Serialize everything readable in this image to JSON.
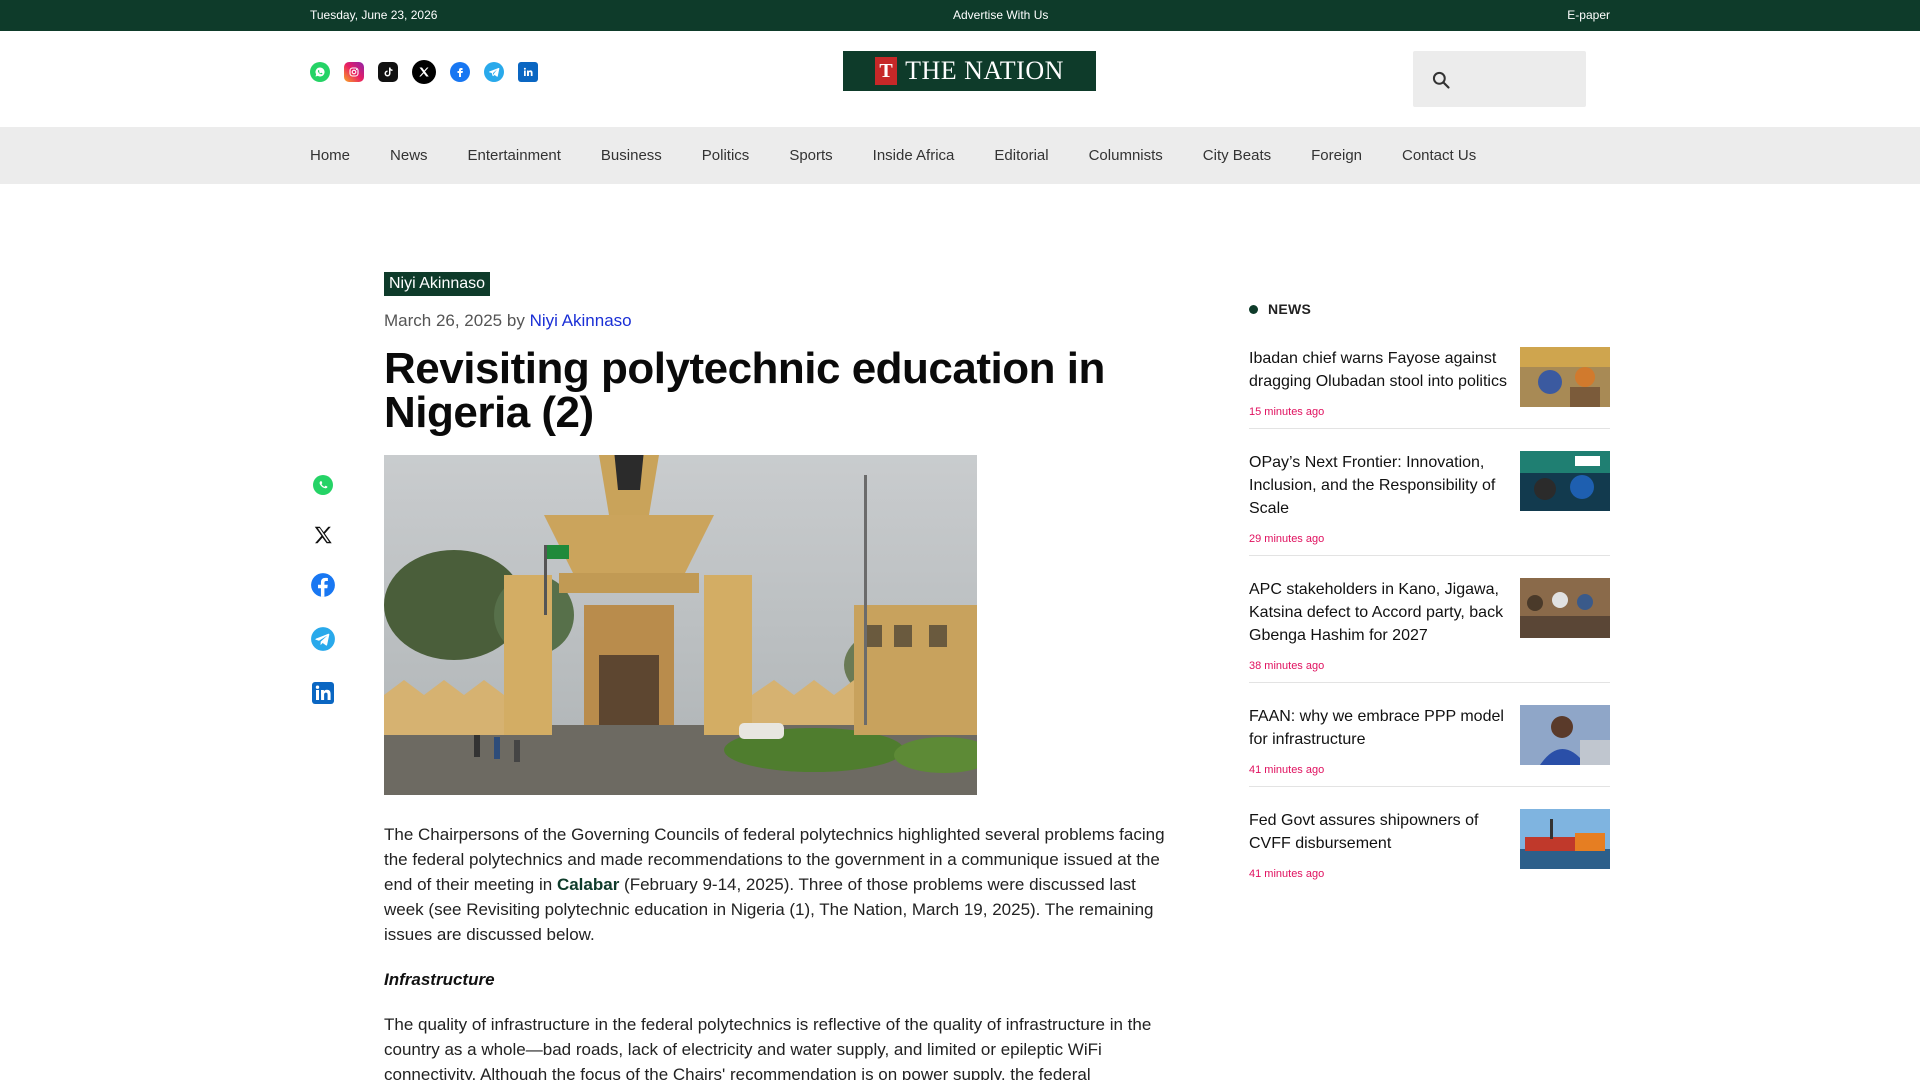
{
  "topbar": {
    "date": "Tuesday, June 23, 2026",
    "advertise": "Advertise With Us",
    "epaper": "E-paper"
  },
  "header": {
    "logo_text": "THE NATION",
    "logo_mark": "T",
    "social_icons": [
      "whatsapp-icon",
      "instagram-icon",
      "tiktok-icon",
      "x-icon",
      "facebook-icon",
      "telegram-icon",
      "linkedin-icon"
    ]
  },
  "nav": {
    "items": [
      "Home",
      "News",
      "Entertainment",
      "Business",
      "Politics",
      "Sports",
      "Inside Africa",
      "Editorial",
      "Columnists",
      "City Beats",
      "Foreign",
      "Contact Us"
    ]
  },
  "article": {
    "category": "Niyi Akinnaso",
    "date": "March 26, 2025",
    "by": "by",
    "author": "Niyi Akinnaso",
    "title": "Revisiting polytechnic education in Nigeria (2)",
    "para1_a": "The Chairpersons of the Governing Councils of federal polytechnics highlighted several problems facing the federal polytechnics and made recommendations to the government in a communique issued at the end of their meeting in ",
    "para1_link": "Calabar",
    "para1_b": " (February 9-14, 2025). Three of those problems were discussed last week (see Revisiting polytechnic education in Nigeria (1), The Nation, March 19, 2025). The remaining issues are discussed below.",
    "subheading": "Infrastructure",
    "para2": "The quality of infrastructure in the federal polytechnics is reflective of the quality of infrastructure in the country as a whole—bad roads, lack of electricity and water supply, and limited or epileptic WiFi connectivity. Although the focus of the Chairs' recommendation is on power supply, the federal"
  },
  "share_icons": [
    "whatsapp-icon",
    "x-icon",
    "facebook-icon",
    "telegram-icon",
    "linkedin-icon"
  ],
  "sidebar": {
    "heading": "NEWS",
    "items": [
      {
        "title": "Ibadan chief warns Fayose against dragging Olubadan stool into politics",
        "ago": "15 minutes ago"
      },
      {
        "title": "OPay’s Next Frontier: Innovation, Inclusion, and the Responsibility of Scale",
        "ago": "29 minutes ago"
      },
      {
        "title": "APC stakeholders in Kano, Jigawa, Katsina defect to Accord party, back Gbenga Hashim for 2027",
        "ago": "38 minutes ago"
      },
      {
        "title": "FAAN: why we embrace PPP model for infrastructure",
        "ago": "41 minutes ago"
      },
      {
        "title": "Fed Govt assures shipowners of CVFF disbursement",
        "ago": "41 minutes ago"
      }
    ]
  },
  "colors": {
    "brand_green": "#0e3b2a",
    "author_link": "#1a2fd6",
    "time_ago": "#e0115f",
    "nav_bg": "#ececec"
  }
}
